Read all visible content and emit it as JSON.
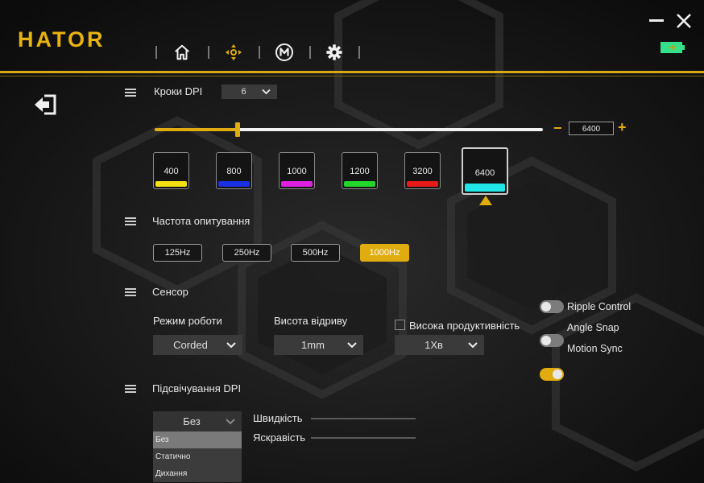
{
  "brand": {
    "logo": "HATOR"
  },
  "nav": {
    "items": [
      {
        "icon": "home-icon"
      },
      {
        "icon": "dpi-target-icon",
        "active": true
      },
      {
        "icon": "macro-m-icon"
      },
      {
        "icon": "gear-icon"
      }
    ]
  },
  "window": {
    "minimize_icon": "minimize-icon",
    "close_icon": "close-icon"
  },
  "battery": {
    "icon": "battery-charging-icon",
    "color": "#35e08a"
  },
  "exit": {
    "icon": "exit-icon"
  },
  "dpi_steps": {
    "label": "Кроки DPI",
    "selected": "6",
    "minus": "−",
    "plus": "+",
    "current_value": "6400",
    "slider_fraction": 0.215,
    "levels": [
      {
        "value": "400",
        "color": "#f2e012"
      },
      {
        "value": "800",
        "color": "#1b2fe3"
      },
      {
        "value": "1000",
        "color": "#e020e0"
      },
      {
        "value": "1200",
        "color": "#22d62a"
      },
      {
        "value": "3200",
        "color": "#e81a1a"
      },
      {
        "value": "6400",
        "color": "#22e6e6",
        "active": true
      }
    ],
    "accent": "#e0ac10"
  },
  "polling": {
    "label": "Частота опитування",
    "options": [
      "125Hz",
      "250Hz",
      "500Hz",
      "1000Hz"
    ],
    "selected": "1000Hz"
  },
  "sensor": {
    "label": "Сенсор",
    "mode_label": "Режим роботи",
    "mode_value": "Corded",
    "lod_label": "Висота відриву",
    "lod_value": "1mm",
    "hp_label": "Висока продуктивність",
    "hp_value": "1Хв",
    "toggles": [
      {
        "label": "Ripple Control",
        "on": false
      },
      {
        "label": "Angle Snap",
        "on": false
      },
      {
        "label": "Motion Sync",
        "on": true
      }
    ]
  },
  "lighting": {
    "label": "Підсвічування DPI",
    "mode_value": "Без",
    "speed_label": "Швидкість",
    "brightness_label": "Яскравість",
    "options": [
      "Без",
      "Статично",
      "Дихання"
    ]
  }
}
